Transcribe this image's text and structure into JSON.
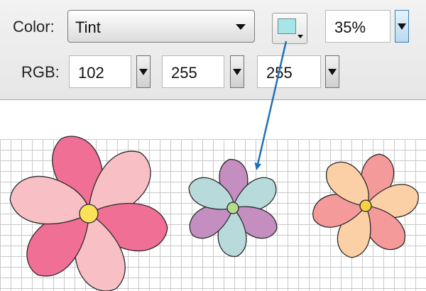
{
  "toolbar": {
    "color_label": "Color:",
    "color_mode": "Tint",
    "tint_swatch_color": "#a6e6e6",
    "tint_percent": "35%",
    "rgb_label": "RGB:",
    "rgb": {
      "r": "102",
      "g": "255",
      "b": "255"
    }
  },
  "flowers": [
    {
      "name": "pink-flower",
      "petal_colors": [
        "#f06f95",
        "#f8c0c4"
      ],
      "center_color": "#f9e15a"
    },
    {
      "name": "tinted-flower",
      "petal_colors": [
        "#c48fc0",
        "#b9dadb"
      ],
      "center_color": "#b4dc8c"
    },
    {
      "name": "peach-flower",
      "petal_colors": [
        "#f49a9a",
        "#fcd0a6"
      ],
      "center_color": "#f8d341"
    }
  ],
  "colors": {
    "arrow": "#1f72b8",
    "grid": "#c8c8c8"
  }
}
